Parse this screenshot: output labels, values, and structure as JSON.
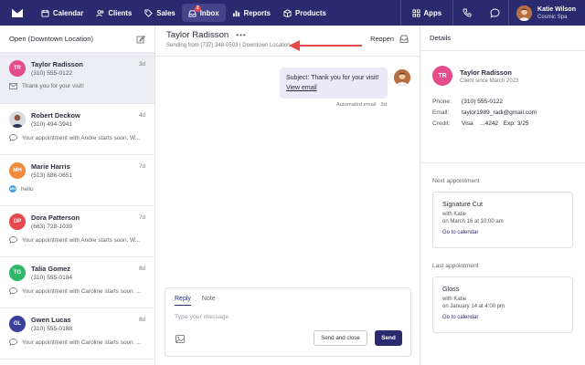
{
  "nav": {
    "items": [
      {
        "label": "Calendar",
        "icon": "calendar-icon"
      },
      {
        "label": "Clients",
        "icon": "users-icon"
      },
      {
        "label": "Sales",
        "icon": "tag-icon"
      },
      {
        "label": "Inbox",
        "icon": "inbox-icon",
        "badge": "2"
      },
      {
        "label": "Reports",
        "icon": "bar-chart-icon"
      },
      {
        "label": "Products",
        "icon": "box-icon"
      }
    ],
    "apps_label": "Apps",
    "user": {
      "name": "Katie Wilson",
      "org": "Cosmic Spa"
    }
  },
  "left": {
    "filter_label": "Open (Downtown Location)",
    "conversations": [
      {
        "initials": "TR",
        "name": "Taylor Radisson",
        "phone": "(310) 555-0122",
        "time": "3d",
        "preview": "Thank you for your visit!",
        "color": "#e34d8c",
        "preview_icon": "email"
      },
      {
        "initials": "",
        "name": "Robert Deckow",
        "phone": "(310) 494-3941",
        "time": "4d",
        "preview": "Your appointment with Andre starts soon. W...",
        "color": "#6b5a4e",
        "preview_icon": "chat"
      },
      {
        "initials": "MH",
        "name": "Marie Harris",
        "phone": "(513) 886-0651",
        "time": "7d",
        "preview": "hello",
        "color": "#f08a3c",
        "preview_icon": "avatar",
        "preview_initials": "MH"
      },
      {
        "initials": "DP",
        "name": "Dora Patterson",
        "phone": "(663) 728-1039",
        "time": "7d",
        "preview": "Your appointment with Andre starts soon. W...",
        "color": "#e5484d",
        "preview_icon": "chat"
      },
      {
        "initials": "TG",
        "name": "Talia Gomez",
        "phone": "(310) 555-0184",
        "time": "8d",
        "preview": "Your appointment with Caroline starts soon. ...",
        "color": "#2fb86b",
        "preview_icon": "chat"
      },
      {
        "initials": "GL",
        "name": "Gwen Lucas",
        "phone": "(310) 555-0188",
        "time": "8d",
        "preview": "Your appointment with Caroline starts soon. ...",
        "color": "#3a3f9e",
        "preview_icon": "chat"
      }
    ]
  },
  "conversation": {
    "title": "Taylor Radisson",
    "subtitle": "Sending from (737) 348-0503 | Downtown Location",
    "reopen_label": "Reopen",
    "message": {
      "text": "Subject: Thank you for your visit!",
      "link": "View email",
      "meta": "Automated email · 3d"
    },
    "composer": {
      "tab_reply": "Reply",
      "tab_note": "Note",
      "placeholder": "Type your message",
      "send_close": "Send and close",
      "send": "Send"
    }
  },
  "details": {
    "title": "Details",
    "client": {
      "initials": "TR",
      "name": "Taylor Radisson",
      "since": "Client since March 2023",
      "phone_label": "Phone:",
      "phone": "(310) 555-0122",
      "email_label": "Email:",
      "email": "taylor1989_radi@gmail.com",
      "credit_label": "Credit:",
      "credit": "Visa    ...4242   Exp: 3/25"
    },
    "next": {
      "section": "Next appointment",
      "service": "Signature Cut",
      "with": "with Katie",
      "date": "on March 16 at 10:00 am",
      "link": "Go to calendar"
    },
    "last": {
      "section": "Last appointment",
      "service": "Gloss",
      "with": "with Katie",
      "date": "on January 14 at 4:00 pm",
      "link": "Go to calendar"
    }
  },
  "colors": {
    "nav_bg": "#2a2a6e",
    "accent": "#2a2a6e",
    "annotation_arrow": "#e5484d"
  }
}
